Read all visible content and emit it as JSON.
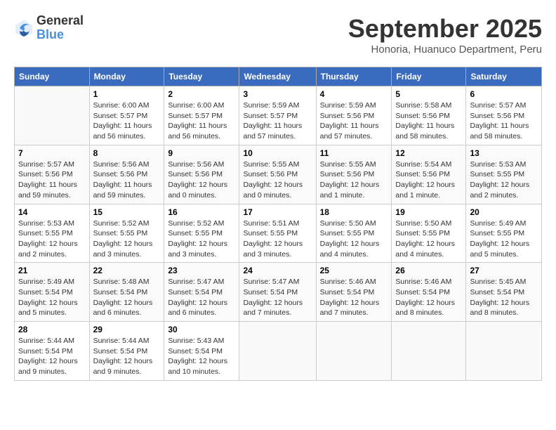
{
  "logo": {
    "general": "General",
    "blue": "Blue"
  },
  "title": "September 2025",
  "location": "Honoria, Huanuco Department, Peru",
  "days_header": [
    "Sunday",
    "Monday",
    "Tuesday",
    "Wednesday",
    "Thursday",
    "Friday",
    "Saturday"
  ],
  "weeks": [
    [
      {
        "day": "",
        "info": ""
      },
      {
        "day": "1",
        "info": "Sunrise: 6:00 AM\nSunset: 5:57 PM\nDaylight: 11 hours\nand 56 minutes."
      },
      {
        "day": "2",
        "info": "Sunrise: 6:00 AM\nSunset: 5:57 PM\nDaylight: 11 hours\nand 56 minutes."
      },
      {
        "day": "3",
        "info": "Sunrise: 5:59 AM\nSunset: 5:57 PM\nDaylight: 11 hours\nand 57 minutes."
      },
      {
        "day": "4",
        "info": "Sunrise: 5:59 AM\nSunset: 5:56 PM\nDaylight: 11 hours\nand 57 minutes."
      },
      {
        "day": "5",
        "info": "Sunrise: 5:58 AM\nSunset: 5:56 PM\nDaylight: 11 hours\nand 58 minutes."
      },
      {
        "day": "6",
        "info": "Sunrise: 5:57 AM\nSunset: 5:56 PM\nDaylight: 11 hours\nand 58 minutes."
      }
    ],
    [
      {
        "day": "7",
        "info": "Sunrise: 5:57 AM\nSunset: 5:56 PM\nDaylight: 11 hours\nand 59 minutes."
      },
      {
        "day": "8",
        "info": "Sunrise: 5:56 AM\nSunset: 5:56 PM\nDaylight: 11 hours\nand 59 minutes."
      },
      {
        "day": "9",
        "info": "Sunrise: 5:56 AM\nSunset: 5:56 PM\nDaylight: 12 hours\nand 0 minutes."
      },
      {
        "day": "10",
        "info": "Sunrise: 5:55 AM\nSunset: 5:56 PM\nDaylight: 12 hours\nand 0 minutes."
      },
      {
        "day": "11",
        "info": "Sunrise: 5:55 AM\nSunset: 5:56 PM\nDaylight: 12 hours\nand 1 minute."
      },
      {
        "day": "12",
        "info": "Sunrise: 5:54 AM\nSunset: 5:56 PM\nDaylight: 12 hours\nand 1 minute."
      },
      {
        "day": "13",
        "info": "Sunrise: 5:53 AM\nSunset: 5:55 PM\nDaylight: 12 hours\nand 2 minutes."
      }
    ],
    [
      {
        "day": "14",
        "info": "Sunrise: 5:53 AM\nSunset: 5:55 PM\nDaylight: 12 hours\nand 2 minutes."
      },
      {
        "day": "15",
        "info": "Sunrise: 5:52 AM\nSunset: 5:55 PM\nDaylight: 12 hours\nand 3 minutes."
      },
      {
        "day": "16",
        "info": "Sunrise: 5:52 AM\nSunset: 5:55 PM\nDaylight: 12 hours\nand 3 minutes."
      },
      {
        "day": "17",
        "info": "Sunrise: 5:51 AM\nSunset: 5:55 PM\nDaylight: 12 hours\nand 3 minutes."
      },
      {
        "day": "18",
        "info": "Sunrise: 5:50 AM\nSunset: 5:55 PM\nDaylight: 12 hours\nand 4 minutes."
      },
      {
        "day": "19",
        "info": "Sunrise: 5:50 AM\nSunset: 5:55 PM\nDaylight: 12 hours\nand 4 minutes."
      },
      {
        "day": "20",
        "info": "Sunrise: 5:49 AM\nSunset: 5:55 PM\nDaylight: 12 hours\nand 5 minutes."
      }
    ],
    [
      {
        "day": "21",
        "info": "Sunrise: 5:49 AM\nSunset: 5:54 PM\nDaylight: 12 hours\nand 5 minutes."
      },
      {
        "day": "22",
        "info": "Sunrise: 5:48 AM\nSunset: 5:54 PM\nDaylight: 12 hours\nand 6 minutes."
      },
      {
        "day": "23",
        "info": "Sunrise: 5:47 AM\nSunset: 5:54 PM\nDaylight: 12 hours\nand 6 minutes."
      },
      {
        "day": "24",
        "info": "Sunrise: 5:47 AM\nSunset: 5:54 PM\nDaylight: 12 hours\nand 7 minutes."
      },
      {
        "day": "25",
        "info": "Sunrise: 5:46 AM\nSunset: 5:54 PM\nDaylight: 12 hours\nand 7 minutes."
      },
      {
        "day": "26",
        "info": "Sunrise: 5:46 AM\nSunset: 5:54 PM\nDaylight: 12 hours\nand 8 minutes."
      },
      {
        "day": "27",
        "info": "Sunrise: 5:45 AM\nSunset: 5:54 PM\nDaylight: 12 hours\nand 8 minutes."
      }
    ],
    [
      {
        "day": "28",
        "info": "Sunrise: 5:44 AM\nSunset: 5:54 PM\nDaylight: 12 hours\nand 9 minutes."
      },
      {
        "day": "29",
        "info": "Sunrise: 5:44 AM\nSunset: 5:54 PM\nDaylight: 12 hours\nand 9 minutes."
      },
      {
        "day": "30",
        "info": "Sunrise: 5:43 AM\nSunset: 5:54 PM\nDaylight: 12 hours\nand 10 minutes."
      },
      {
        "day": "",
        "info": ""
      },
      {
        "day": "",
        "info": ""
      },
      {
        "day": "",
        "info": ""
      },
      {
        "day": "",
        "info": ""
      }
    ]
  ]
}
